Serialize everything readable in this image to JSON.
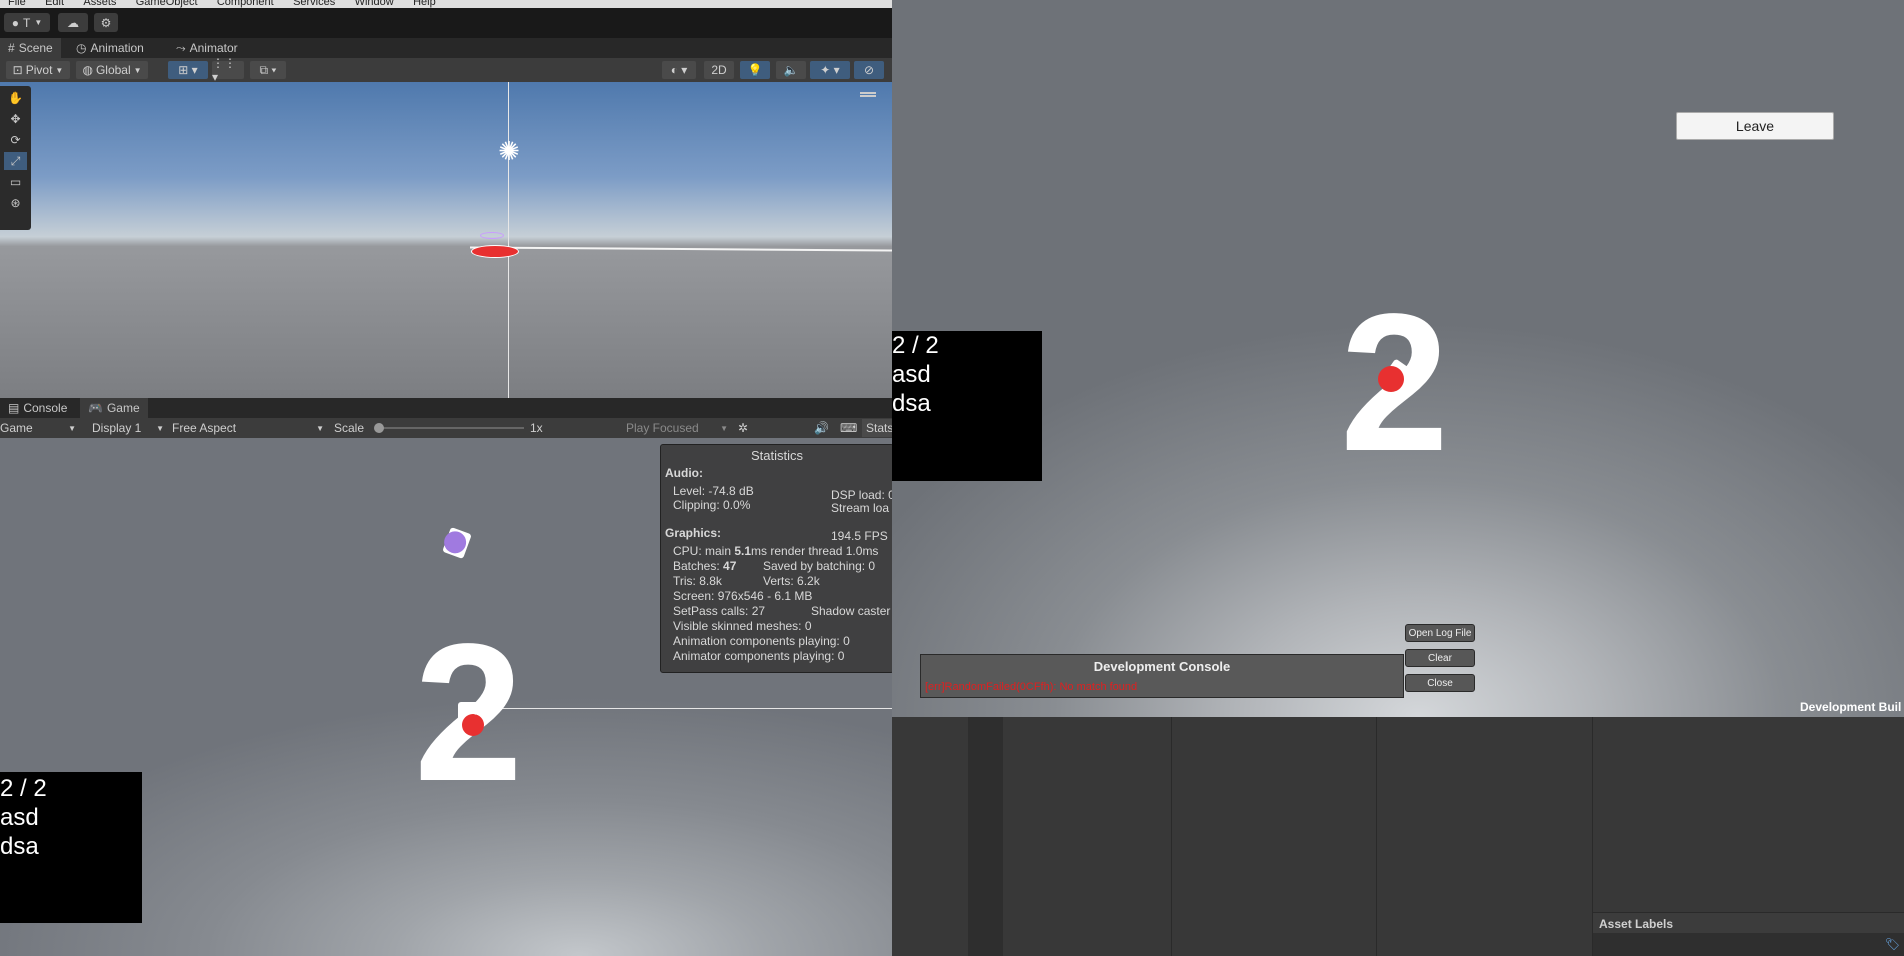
{
  "menubar": [
    "File",
    "Edit",
    "Assets",
    "GameObject",
    "Component",
    "Services",
    "Window",
    "Help"
  ],
  "toolbar": {
    "account_label": "T"
  },
  "scene_tabs": [
    {
      "label": "Scene",
      "icon": "grid-icon"
    },
    {
      "label": "Animation",
      "icon": "clock-icon"
    },
    {
      "label": "Animator",
      "icon": "animator-icon"
    }
  ],
  "scene_toolbar": {
    "pivot": "Pivot",
    "global": "Global",
    "mode_2d": "2D"
  },
  "bottom_tabs": [
    {
      "label": "Console",
      "icon": "console-icon"
    },
    {
      "label": "Game",
      "icon": "gamepad-icon"
    }
  ],
  "game_toolbar": {
    "view": "Game",
    "display": "Display 1",
    "aspect": "Free Aspect",
    "scale_label": "Scale",
    "scale_value": "1x",
    "play_mode": "Play Focused",
    "stats": "Stats"
  },
  "statistics": {
    "title": "Statistics",
    "audio_header": "Audio:",
    "level": "Level: -74.8 dB",
    "clipping": "Clipping: 0.0%",
    "dsp_load": "DSP load: 0",
    "stream_load": "Stream loa",
    "graphics_header": "Graphics:",
    "fps": "194.5 FPS",
    "cpu_prefix": "CPU: main ",
    "cpu_main": "5.1",
    "cpu_suffix": "ms  render thread 1.0ms",
    "batches_prefix": "Batches: ",
    "batches": "47",
    "saved_batching": "Saved by batching: 0",
    "tris": "Tris: 8.8k",
    "verts": "Verts: 6.2k",
    "screen": "Screen: 976x546 - 6.1 MB",
    "setpass": "SetPass calls: 27",
    "shadow": "Shadow caster",
    "skinned": "Visible skinned meshes: 0",
    "anim_playing": "Animation components playing: 0",
    "animator_playing": "Animator components playing: 0"
  },
  "hud": {
    "count": "2 / 2",
    "line1": "asd",
    "line2": "dsa",
    "big_number": "2"
  },
  "build_window": {
    "leave_button": "Leave",
    "console_title": "Development Console",
    "console_error": "[err]RandomFailed(0CFfh): No match found",
    "open_log_button": "Open Log File",
    "clear_button": "Clear",
    "close_button": "Close",
    "build_label": "Development Buil"
  },
  "inspector": {
    "asset_labels": "Asset Labels"
  },
  "colors": {
    "accent_red": "#e83030",
    "player_purple": "#a07ae0",
    "error_red": "#e02020",
    "selected_tool": "#3f5d7e"
  }
}
